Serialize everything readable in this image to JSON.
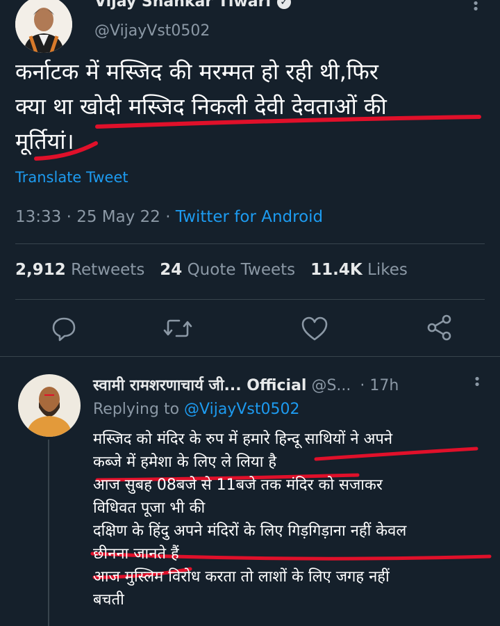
{
  "tweet": {
    "author_name": "Vijay Shankar Tiwari",
    "handle": "@VijayVst0502",
    "text_lines": [
      "कर्नाटक में मस्जिद की मरम्मत हो रही थी,फिर",
      "क्या था खोदी मस्जिद निकली देवी देवताओं की",
      "मूर्तियां।"
    ],
    "translate_label": "Translate Tweet",
    "time": "13:33",
    "date": "25 May 22",
    "source": "Twitter for Android",
    "retweets_count": "2,912",
    "retweets_label": "Retweets",
    "quotes_count": "24",
    "quotes_label": "Quote Tweets",
    "likes_count": "11.4K",
    "likes_label": "Likes",
    "icons": [
      "reply-icon",
      "retweet-icon",
      "like-icon",
      "share-icon"
    ]
  },
  "reply": {
    "author_name": "स्वामी रामशरणाचार्य जी... Official",
    "handle": "@S...",
    "time_ago": "· 17h",
    "replying_prefix": "Replying to",
    "replying_to": "@VijayVst0502",
    "lines": [
      "मस्जिद को मंदिर के रुप में हमारे हिन्दू साथियों ने अपने",
      "कब्जे में हमेशा के लिए ले लिया है",
      "आज सुबह 08बजे से 11बजे तक मंदिर को सजाकर",
      "विधिवत पूजा भी की",
      "दक्षिण के हिंदु अपने मंदिरों के लिए गिड़गिड़ाना नहीं केवल",
      "छीनना जानते हैं",
      "आज मुस्लिम विरोध करता तो लाशों के लिए जगह नहीं",
      "बचती"
    ]
  },
  "annotation_color": "#e0102a"
}
